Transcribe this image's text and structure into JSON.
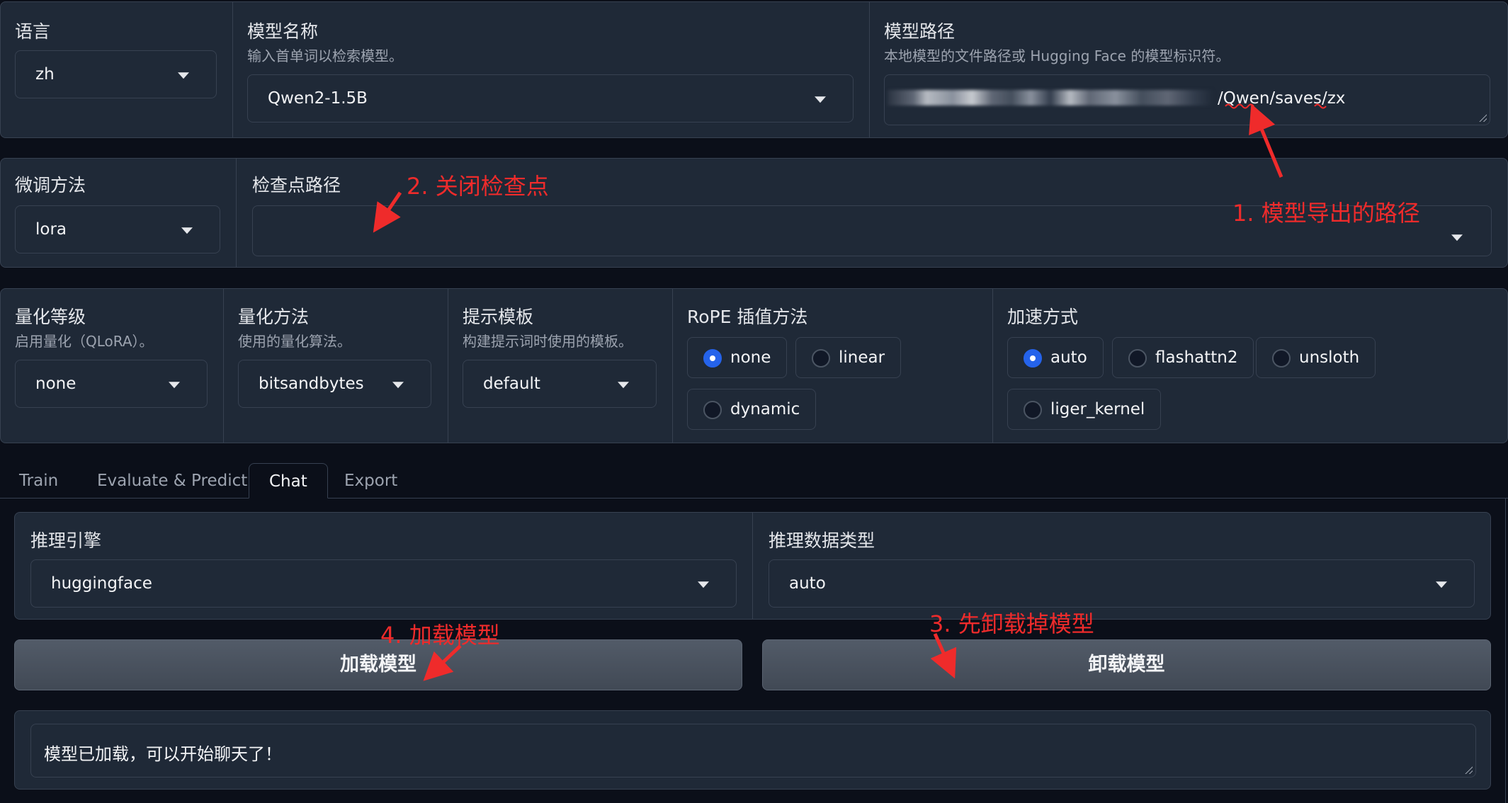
{
  "top": {
    "language": {
      "label": "语言",
      "value": "zh"
    },
    "model_name": {
      "label": "模型名称",
      "info": "输入首单词以检索模型。",
      "value": "Qwen2-1.5B"
    },
    "model_path": {
      "label": "模型路径",
      "info": "本地模型的文件路径或 Hugging Face 的模型标识符。",
      "value": "/Qwen/saves/zx"
    }
  },
  "row2": {
    "finetune": {
      "label": "微调方法",
      "value": "lora"
    },
    "checkpoint": {
      "label": "检查点路径",
      "value": ""
    }
  },
  "row3": {
    "quant_bit": {
      "label": "量化等级",
      "info": "启用量化（QLoRA）。",
      "value": "none"
    },
    "quant_method": {
      "label": "量化方法",
      "info": "使用的量化算法。",
      "value": "bitsandbytes"
    },
    "template": {
      "label": "提示模板",
      "info": "构建提示词时使用的模板。",
      "value": "default"
    },
    "rope": {
      "label": "RoPE 插值方法",
      "options": [
        "none",
        "linear",
        "dynamic"
      ],
      "selected": "none"
    },
    "booster": {
      "label": "加速方式",
      "options": [
        "auto",
        "flashattn2",
        "unsloth",
        "liger_kernel"
      ],
      "selected": "auto"
    }
  },
  "tabs": [
    "Train",
    "Evaluate & Predict",
    "Chat",
    "Export"
  ],
  "active_tab": "Chat",
  "chat": {
    "infer_backend": {
      "label": "推理引擎",
      "value": "huggingface"
    },
    "infer_dtype": {
      "label": "推理数据类型",
      "value": "auto"
    },
    "load_button": "加载模型",
    "unload_button": "卸载模型",
    "info_box": "模型已加载，可以开始聊天了！"
  },
  "annotations": {
    "a1": "1. 模型导出的路径",
    "a2": "2. 关闭检查点",
    "a3": "3. 先卸载掉模型",
    "a4": "4. 加载模型"
  },
  "colors": {
    "background": "#0b0f19",
    "panel": "#1f2937",
    "border": "#374151",
    "radio_selected": "#2563eb",
    "annotation": "#ef2b2b"
  }
}
